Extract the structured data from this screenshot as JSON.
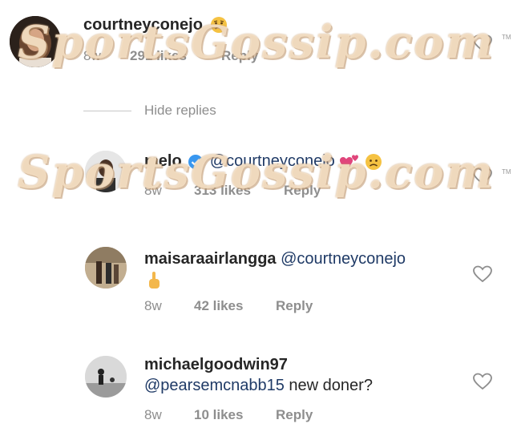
{
  "comments": [
    {
      "username": "courtneyconejo",
      "text": "",
      "time": "8w",
      "likes": "291 likes",
      "reply": "Reply"
    },
    {
      "username": "melo",
      "text": "@courtneyconejo",
      "time": "8w",
      "likes": "313 likes",
      "reply": "Reply"
    },
    {
      "username": "maisaraairlangga",
      "text": "@courtneyconejo",
      "time": "8w",
      "likes": "42 likes",
      "reply": "Reply"
    },
    {
      "username": "michaelgoodwin97",
      "mention": "@pearsemcnabb15",
      "text": "new doner?",
      "time": "8w",
      "likes": "10 likes",
      "reply": "Reply"
    }
  ],
  "hide_replies": "Hide replies",
  "watermark": "SportsGossip.com",
  "trademark": "TM",
  "colors": {
    "mention": "#1f3a66",
    "meta": "#8e8e8e",
    "verified": "#3897f0"
  },
  "icons": [
    "heart-icon",
    "verified-badge-icon",
    "sad-face-emoji",
    "two-hearts-emoji",
    "middle-finger-emoji"
  ]
}
